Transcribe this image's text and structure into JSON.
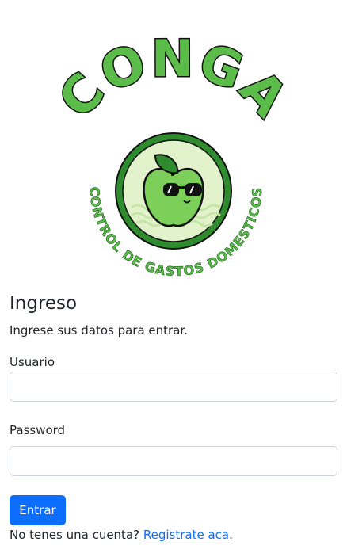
{
  "logo": {
    "brand": "CONGA",
    "tagline": "CONTROL DE GASTOS DOMESTICOS",
    "colors": {
      "green_dark": "#2e8b2e",
      "green_mid": "#5cbc4a",
      "green_light": "#e2f3cc",
      "outline": "#111111"
    }
  },
  "login": {
    "title": "Ingreso",
    "subtitle": "Ingrese sus datos para entrar.",
    "username_label": "Usuario",
    "username_value": "",
    "password_label": "Password",
    "password_value": "",
    "submit_label": "Entrar",
    "footer_text": "No tenes una cuenta? ",
    "register_link": "Registrate aca",
    "footer_end": "."
  },
  "colors": {
    "primary": "#0d6efd",
    "text": "#212529",
    "border": "#ced4da"
  }
}
